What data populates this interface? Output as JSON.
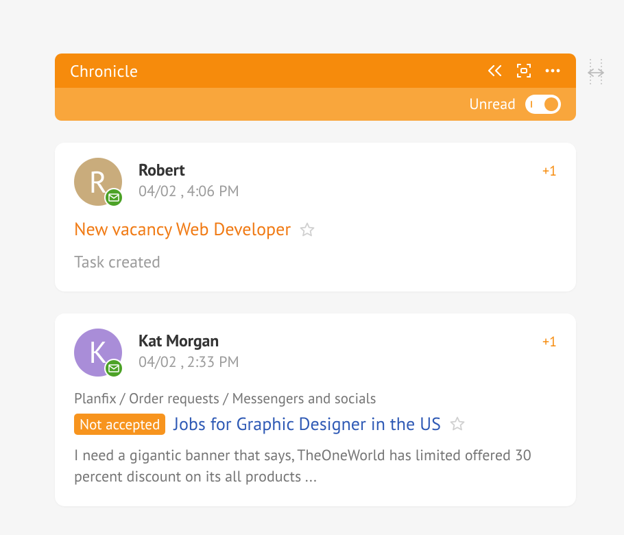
{
  "header": {
    "title": "Chronicle",
    "unread_label": "Unread"
  },
  "cards": [
    {
      "avatar_initial": "R",
      "avatar_class": "avatar-robert",
      "author": "Robert",
      "timestamp": "04/02 , 4:06 PM",
      "plus_count": "+1",
      "subject": "New vacancy Web Developer",
      "subject_class": "subject-orange",
      "body": "Task created"
    },
    {
      "avatar_initial": "К",
      "avatar_class": "avatar-kat",
      "author": "Kat Morgan",
      "timestamp": "04/02 , 2:33 PM",
      "plus_count": "+1",
      "breadcrumb": "Planfix / Order requests / Messengers and socials",
      "badge": "Not accepted",
      "subject": "Jobs for Graphic Designer in the US",
      "subject_class": "subject-blue",
      "snippet": "I need a gigantic banner that says, TheOneWorld has limited offered 30 percent discount on its all products ..."
    }
  ]
}
